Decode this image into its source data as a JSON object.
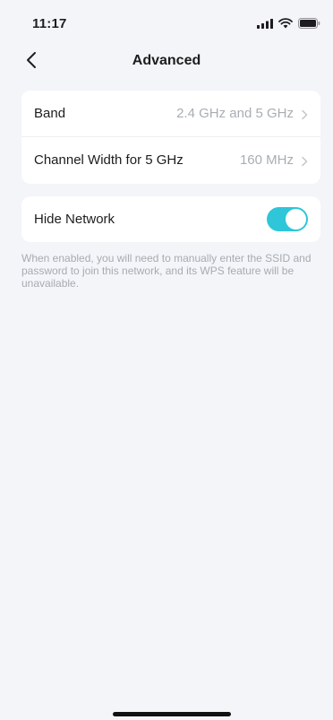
{
  "status_bar": {
    "time": "11:17"
  },
  "header": {
    "title": "Advanced",
    "back_icon": "chevron-left-icon"
  },
  "settings": {
    "rows": [
      {
        "label": "Band",
        "value": "2.4 GHz and 5 GHz"
      },
      {
        "label": "Channel Width for 5 GHz",
        "value": "160 MHz"
      }
    ],
    "hide_network": {
      "label": "Hide Network",
      "enabled": true
    },
    "hint": "When enabled, you will need to manually enter the SSID and password to join this network, and its WPS feature will be unavailable."
  },
  "colors": {
    "accent": "#2ec6d8",
    "background": "#f3f5f8",
    "secondary_text": "#a9adb3"
  }
}
